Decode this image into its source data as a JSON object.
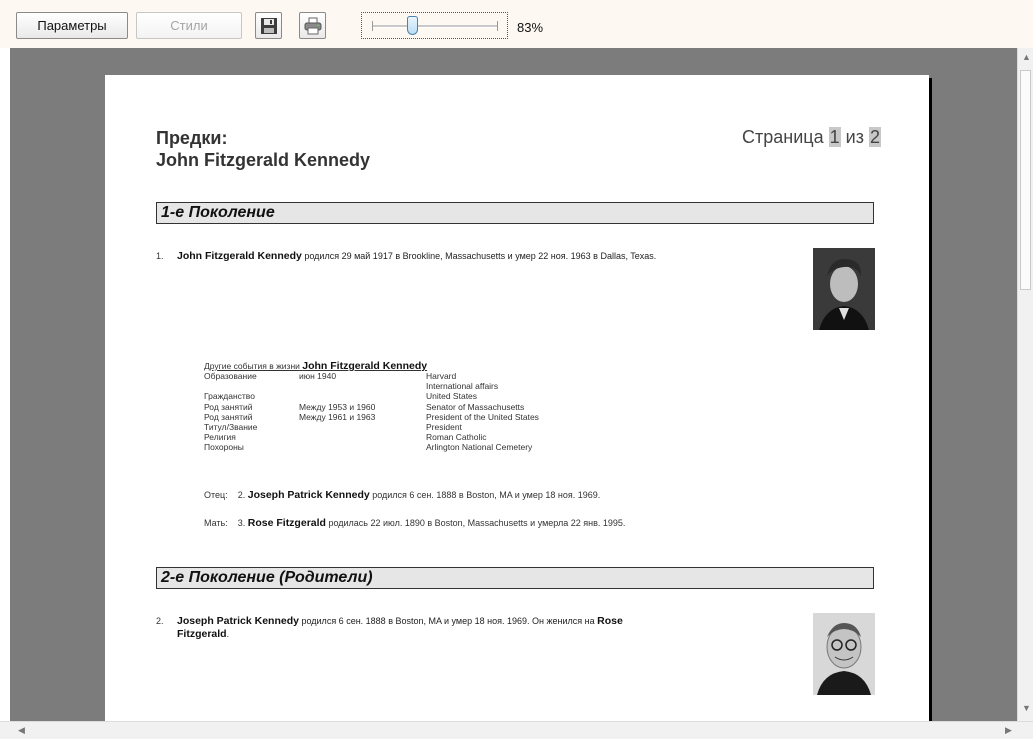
{
  "toolbar": {
    "params_label": "Параметры",
    "styles_label": "Стили",
    "save_icon": "floppy-disk-icon",
    "print_icon": "printer-icon",
    "zoom_value": "83%",
    "zoom_level_fraction": 0.32
  },
  "page": {
    "title_line1": "Предки:",
    "title_line2": "John Fitzgerald Kennedy",
    "page_prefix": "Страница",
    "page_current": "1",
    "page_of": "из",
    "page_total": "2"
  },
  "gen1": {
    "header": "1-е Поколение",
    "entry_num": "1.",
    "name": "John Fitzgerald Kennedy",
    "text": " родился  29 май 1917 в Brookline, Massachusetts и умер  22 ноя. 1963 в Dallas, Texas.",
    "events_title_prefix": "Другие события в жизни ",
    "events_title_name": "John Fitzgerald Kennedy",
    "events": [
      {
        "type": "Образование",
        "date": "июн 1940",
        "desc": "Harvard"
      },
      {
        "type": "",
        "date": "",
        "desc": "International affairs"
      },
      {
        "type": "Гражданство",
        "date": "",
        "desc": "United States"
      },
      {
        "type": "Род занятий",
        "date": "Между 1953 и 1960",
        "desc": "Senator of Massachusetts"
      },
      {
        "type": "Род занятий",
        "date": "Между 1961 и 1963",
        "desc": "President of the United States"
      },
      {
        "type": "Титул/Звание",
        "date": "",
        "desc": "President"
      },
      {
        "type": "Религия",
        "date": "",
        "desc": "Roman Catholic"
      },
      {
        "type": "Похороны",
        "date": "",
        "desc": "Arlington National Cemetery"
      }
    ],
    "father_label": "Отец:",
    "father_num": "2.",
    "father_name": "Joseph Patrick Kennedy",
    "father_text": " родился  6 сен. 1888 в Boston, MA и умер  18 ноя. 1969.",
    "mother_label": "Мать:",
    "mother_num": "3.",
    "mother_name": "Rose Fitzgerald",
    "mother_text": " родилась  22 июл. 1890 в Boston, Massachusetts и умерла  22 янв. 1995."
  },
  "gen2": {
    "header": "2-е Поколение (Родители)",
    "entry_num": "2.",
    "name": "Joseph Patrick Kennedy",
    "text": " родился  6 сен. 1888 в Boston, MA и умер  18 ноя. 1969. Он женился на ",
    "spouse": "Rose",
    "spouse_line2": "Fitzgerald",
    "tail": "."
  }
}
